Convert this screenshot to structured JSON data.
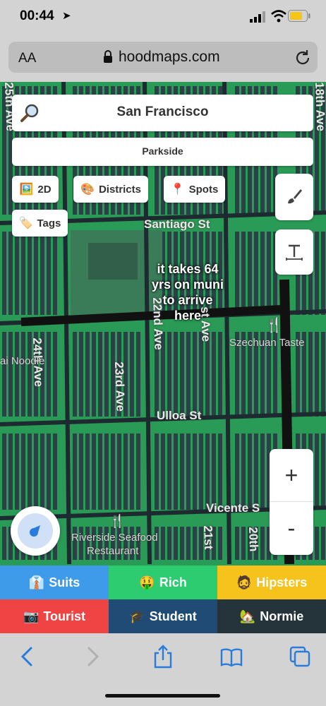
{
  "status_bar": {
    "time": "00:44",
    "location_arrow": "location-arrow-icon"
  },
  "url_bar": {
    "text_size_label": "AA",
    "url": "hoodmaps.com"
  },
  "search": {
    "city": "San Francisco",
    "neighborhood": "Parkside"
  },
  "controls": {
    "mode_2d": {
      "emoji": "🖼️",
      "label": "2D"
    },
    "districts": {
      "emoji": "🎨",
      "label": "Districts"
    },
    "spots": {
      "emoji": "📍",
      "label": "Spots"
    },
    "tags": {
      "emoji": "🏷️",
      "label": "Tags"
    },
    "zoom_in": "+",
    "zoom_out": "-"
  },
  "map": {
    "streets": {
      "santiago": "Santiago St",
      "ulloa": "Ulloa St",
      "vicente": "Vicente S",
      "ave_24": "24th Ave",
      "ave_23": "23rd Ave",
      "ave_22": "22nd Ave",
      "ave_21": "21st",
      "ave_20": "20th",
      "ave_25": "25th Ave",
      "ave_18": "18th Ave",
      "first_ave": "st Ave"
    },
    "pois": {
      "szechuan": "Szechuan Taste",
      "noodle": "ai Noodle",
      "riverside_1": "Riverside Seafood",
      "riverside_2": "Restaurant"
    },
    "user_tag_lines": [
      "it takes 64",
      "yrs on muni",
      "to arrive",
      "here"
    ]
  },
  "categories": [
    {
      "emoji": "👔",
      "label": "Suits",
      "color": "#3d9be9"
    },
    {
      "emoji": "🤑",
      "label": "Rich",
      "color": "#2ecc71"
    },
    {
      "emoji": "🧔",
      "label": "Hipsters",
      "color": "#f5c31b"
    },
    {
      "emoji": "📷",
      "label": "Tourist",
      "color": "#f04343"
    },
    {
      "emoji": "🎓",
      "label": "Student",
      "color": "#1f4b74"
    },
    {
      "emoji": "🏡",
      "label": "Normie",
      "color": "#25333a"
    }
  ],
  "colors": {
    "map_green": "#2a9b56",
    "blocks": "#2b3a45",
    "chrome_gray": "#d3d3d3",
    "ios_blue": "#2a7bdc"
  }
}
